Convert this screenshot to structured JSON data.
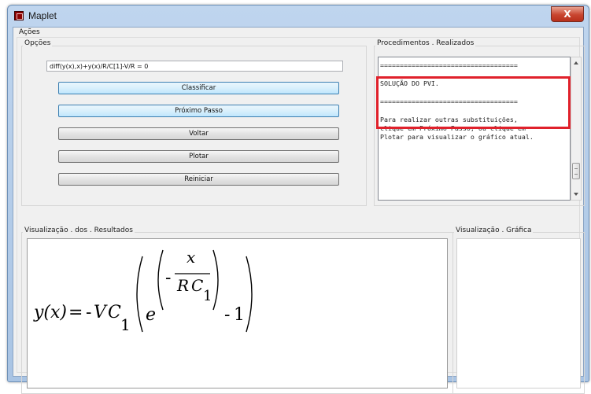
{
  "window": {
    "title": "Maplet",
    "close_glyph": "X",
    "app_icon": "maple-icon"
  },
  "acoes": {
    "label": "Ações"
  },
  "opcoes": {
    "label": "Opções",
    "expression_value": "diff(y(x),x)+y(x)/R/C[1]-V/R = 0",
    "buttons": {
      "classificar": "Classificar",
      "proximo_passo": "Próximo Passo",
      "voltar": "Voltar",
      "plotar": "Plotar",
      "reiniciar": "Reiniciar"
    }
  },
  "procedimentos": {
    "label": "Procedimentos . Realizados",
    "lines": [
      "===================================",
      "",
      "SOLUÇÃO DO PVI.",
      "",
      "===================================",
      "",
      "Para realizar outras substituições,",
      "clique em Próximo Passo, ou clique em",
      "Plotar para visualizar o gráfico atual."
    ]
  },
  "visualizacao_resultados": {
    "label": "Visualização . dos . Resultados",
    "formula": {
      "lhs": "y(x)",
      "equals": "=",
      "minus": "-",
      "V": "V",
      "C": "C",
      "sub1": "1",
      "e": "e",
      "x": "x",
      "R": "R",
      "one": "1"
    }
  },
  "visualizacao_grafica": {
    "label": "Visualização . Gráfica"
  },
  "colors": {
    "highlight": "#e0212b",
    "blue_button": "#bee6fd"
  }
}
